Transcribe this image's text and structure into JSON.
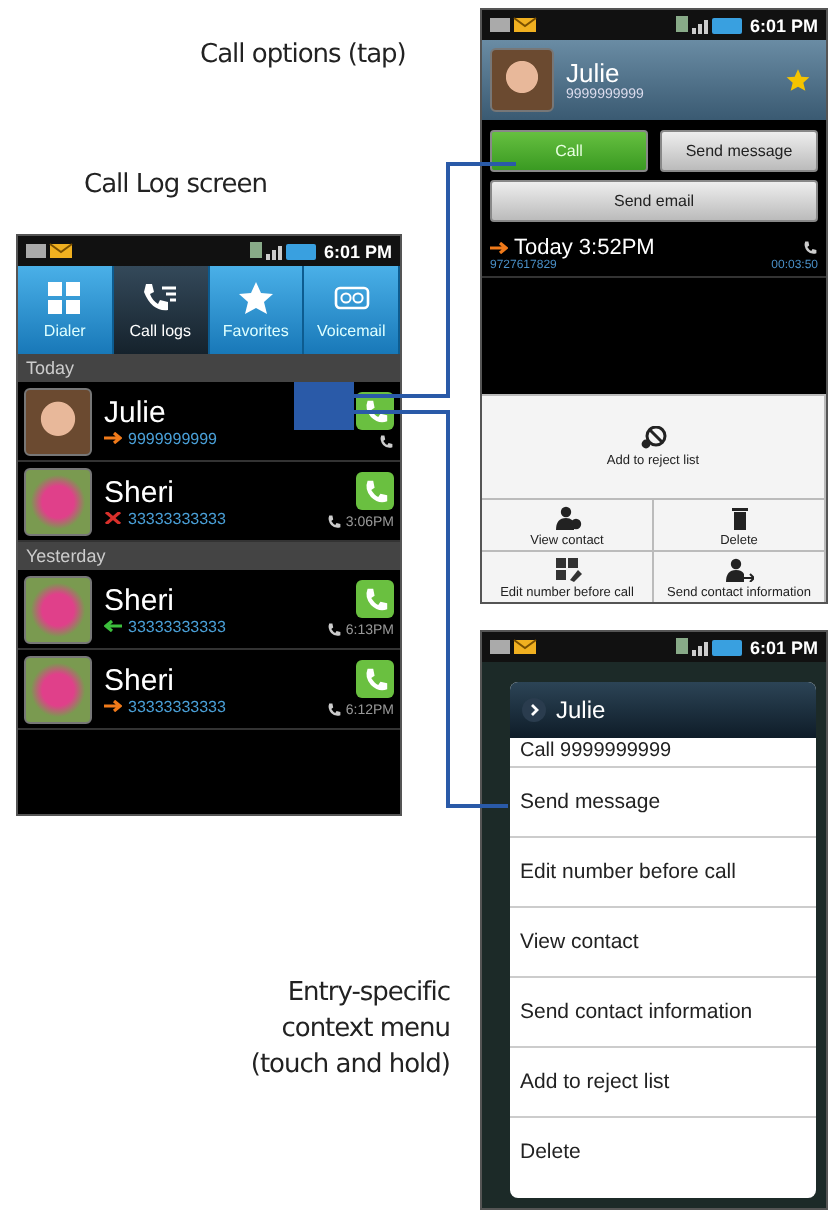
{
  "captions": [
    {
      "kind": "call_options",
      "text": "Call options (tap)"
    },
    {
      "kind": "call_log",
      "text": "Call Log screen"
    },
    {
      "kind": "context_menu",
      "lines": [
        "Entry-specific",
        "context menu",
        "(touch and hold)"
      ]
    }
  ],
  "call_log_screen": {
    "status_time": "6:01 PM",
    "tabs": [
      {
        "label": "Dialer",
        "selected": false
      },
      {
        "label": "Call logs",
        "selected": true
      },
      {
        "label": "Favorites",
        "selected": false
      },
      {
        "label": "Voicemail",
        "selected": false
      }
    ],
    "sections": [
      {
        "title": "Today",
        "entries": [
          {
            "name": "Julie",
            "number": "9999999999",
            "kind": "outgoing",
            "portrait": true,
            "highlighted": true
          },
          {
            "name": "Sheri",
            "number": "33333333333",
            "kind": "missed",
            "portrait": false,
            "time": "3:06PM",
            "highlighted": false
          }
        ]
      },
      {
        "title": "Yesterday",
        "entries": [
          {
            "name": "Sheri",
            "number": "33333333333",
            "kind": "incoming",
            "portrait": false,
            "time": "6:13PM",
            "highlighted": false
          },
          {
            "name": "Sheri",
            "number": "33333333333",
            "kind": "outgoing",
            "portrait": false,
            "time": "6:12PM",
            "highlighted": false
          }
        ]
      }
    ]
  },
  "call_options_screen": {
    "status_time": "6:01 PM",
    "contact": {
      "name": "Julie",
      "number": "9999999999",
      "favorite": true
    },
    "buttons": [
      {
        "label": "Call",
        "kind": "primary"
      },
      {
        "label": "Send message",
        "kind": "secondary"
      },
      {
        "label": "Send email",
        "kind": "wide"
      }
    ],
    "history": {
      "kind": "outgoing",
      "label": "Today 3:52PM",
      "number": "9727617829",
      "duration": "00:03:50"
    },
    "options": [
      {
        "label": "Add to reject list",
        "kind": "reject"
      },
      {
        "label": "View contact",
        "kind": "contact"
      },
      {
        "label": "Delete",
        "kind": "delete"
      },
      {
        "label": "Edit number before call",
        "kind": "edit"
      },
      {
        "label": "Send contact information",
        "kind": "share"
      }
    ]
  },
  "context_menu_screen": {
    "status_time": "6:01 PM",
    "title": "Julie",
    "items": [
      "Call 9999999999",
      "Send message",
      "Edit number before call",
      "View contact",
      "Send contact information",
      "Add to reject list",
      "Delete"
    ]
  }
}
